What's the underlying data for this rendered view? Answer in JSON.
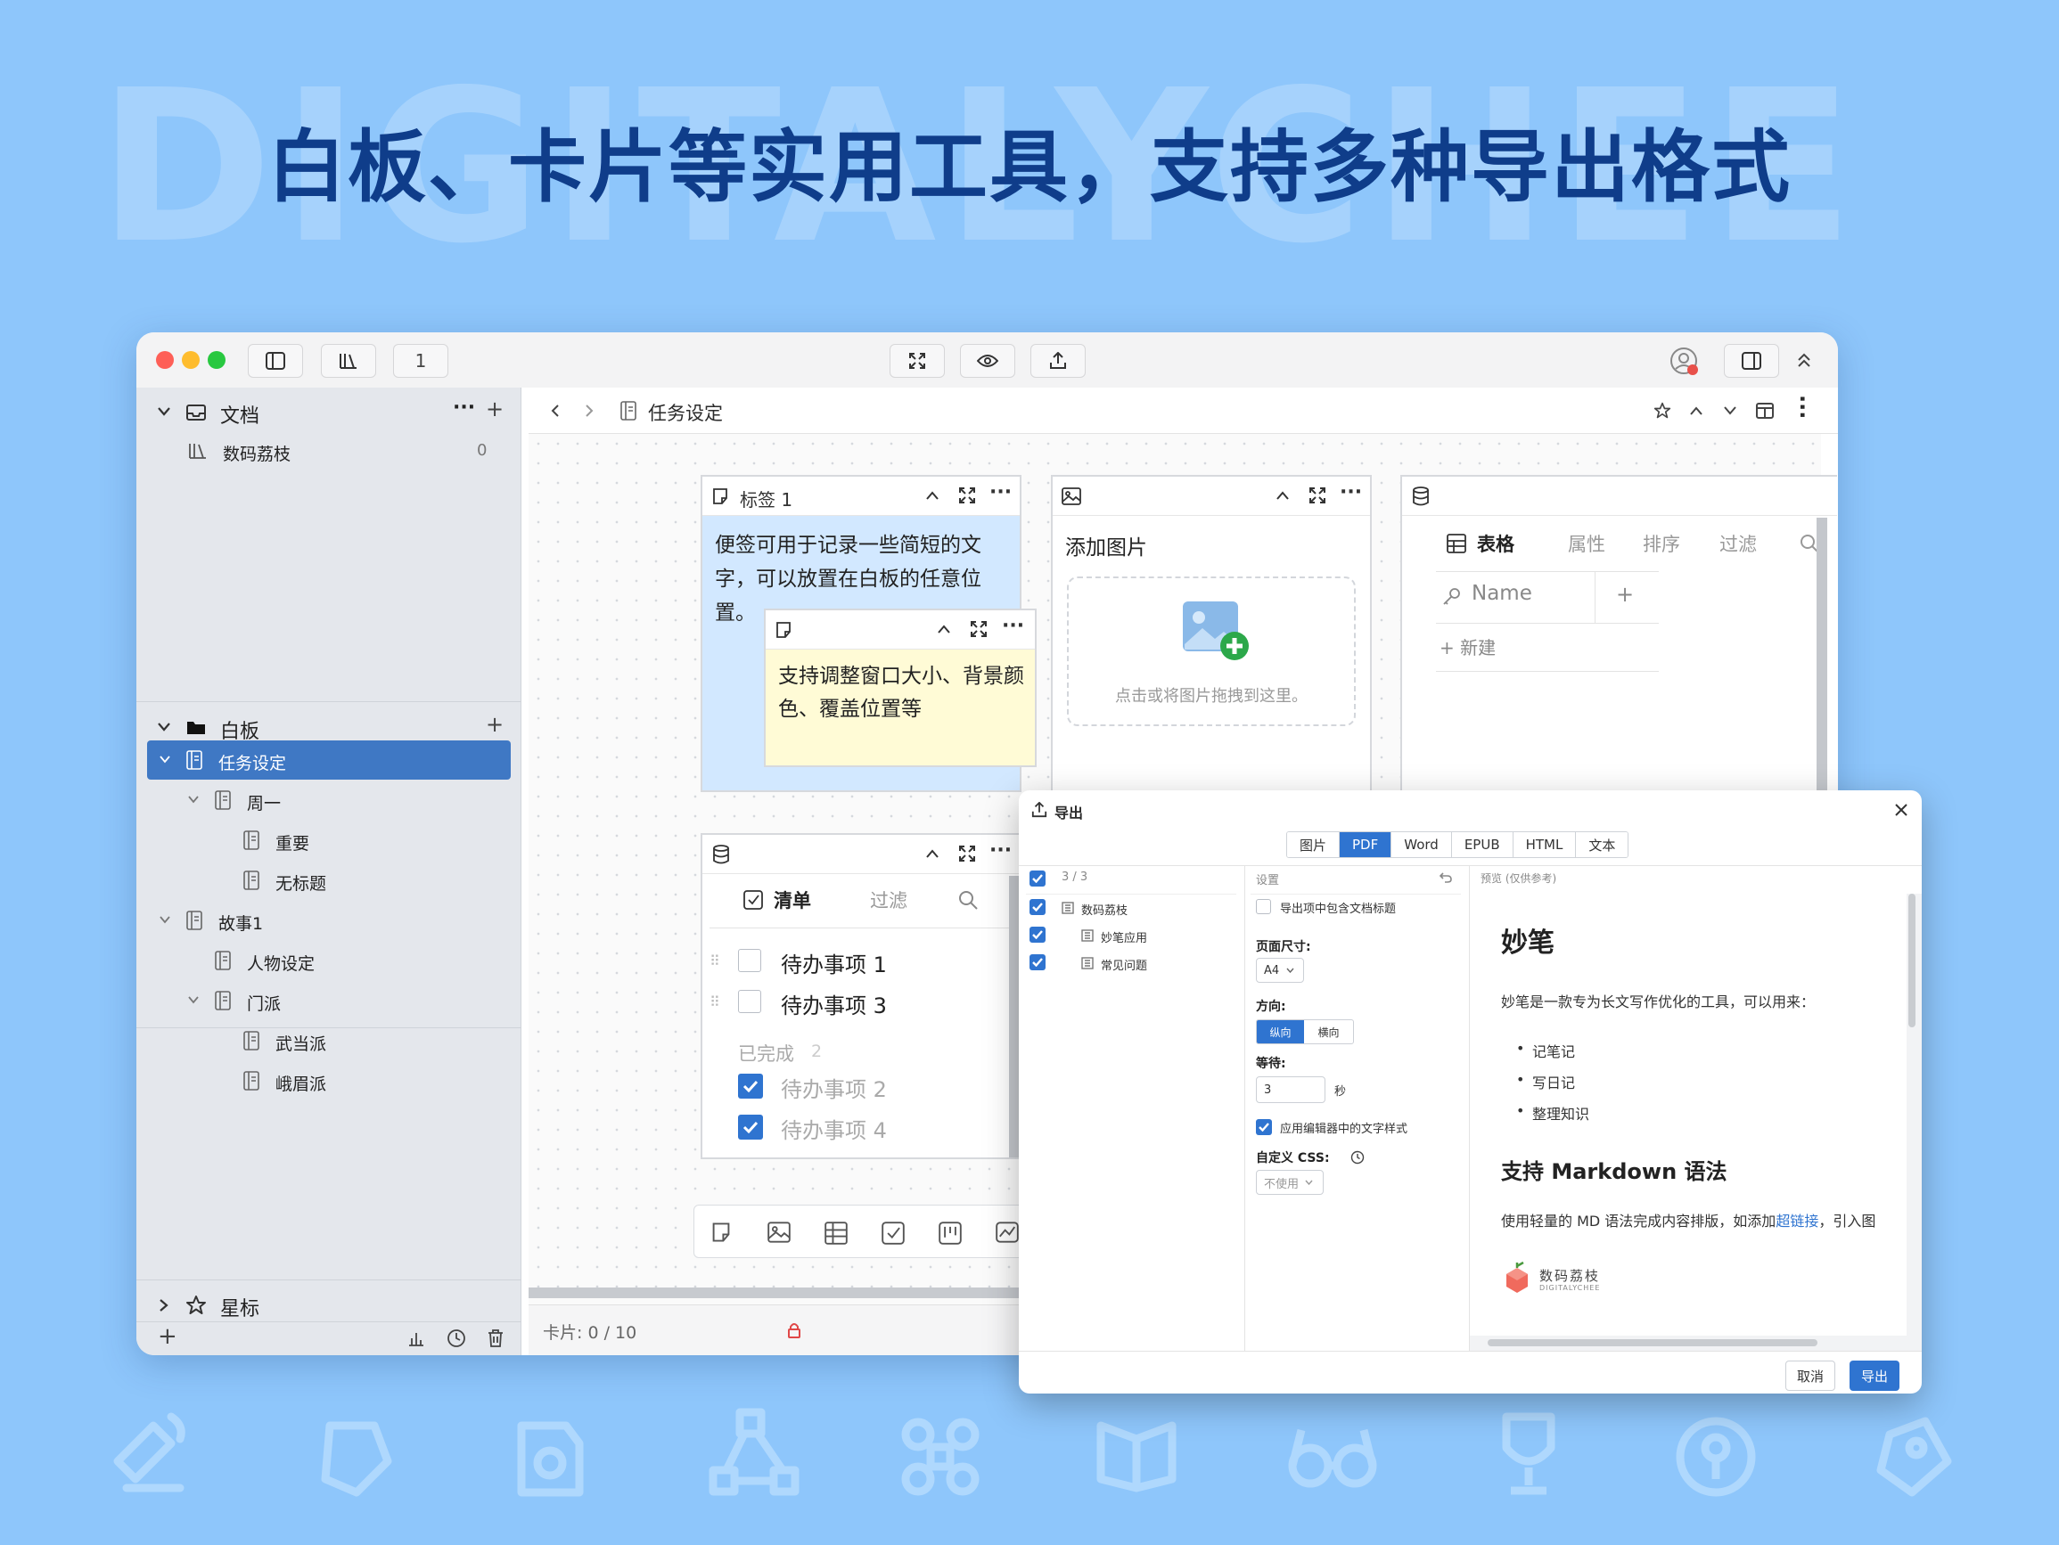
{
  "background": {
    "watermark": "DIGITALYCHEE",
    "headline": "白板、卡片等实用工具，支持多种导出格式",
    "color": "#8ec6fb",
    "icons": [
      "pen-wave-icon",
      "sticky-note-icon",
      "image-lock-icon",
      "vector-nodes-icon",
      "command-icon",
      "book-icon",
      "glasses-icon",
      "trophy-icon",
      "key-icon",
      "tag-icon"
    ]
  },
  "window": {
    "toolbar": {
      "page_count": "1"
    },
    "sidebar": {
      "docs": {
        "title": "文档",
        "items": [
          {
            "label": "数码荔枝",
            "count": "0"
          }
        ]
      },
      "board": {
        "title": "白板",
        "items": [
          {
            "label": "任务设定"
          },
          {
            "label": "周一"
          },
          {
            "label": "重要"
          },
          {
            "label": "无标题"
          },
          {
            "label": "故事1"
          },
          {
            "label": "人物设定"
          },
          {
            "label": "门派"
          },
          {
            "label": "武当派"
          },
          {
            "label": "峨眉派"
          }
        ]
      },
      "starred": {
        "title": "星标"
      }
    },
    "main": {
      "breadcrumb": "任务设定",
      "note_card": {
        "title": "标签 1",
        "text": "便签可用于记录一些简短的文字，可以放置在白板的任意位置。"
      },
      "sub_note": {
        "text": "支持调整窗口大小、背景颜色、覆盖位置等"
      },
      "image_card": {
        "title": "添加图片",
        "hint": "点击或将图片拖拽到这里。"
      },
      "table_card": {
        "tabs": [
          "表格",
          "属性",
          "排序",
          "过滤"
        ],
        "column": "Name",
        "new_label": "+ 新建"
      },
      "todo_card": {
        "tabs": [
          "清单",
          "过滤"
        ],
        "open": [
          "待办事项 1",
          "待办事项 3"
        ],
        "done_label": "已完成",
        "done_count": "2",
        "done": [
          "待办事项 2",
          "待办事项 4"
        ]
      },
      "status": "卡片: 0 / 10"
    }
  },
  "export_dialog": {
    "title": "导出",
    "tabs": [
      "图片",
      "PDF",
      "Word",
      "EPUB",
      "HTML",
      "文本"
    ],
    "active_tab": "PDF",
    "selection_count": "3 / 3",
    "tree": [
      {
        "label": "数码荔枝",
        "checked": true
      },
      {
        "label": "妙笔应用",
        "checked": true
      },
      {
        "label": "常见问题",
        "checked": true
      }
    ],
    "settings": {
      "header": "设置",
      "include_title": "导出项中包含文档标题",
      "page_size_label": "页面尺寸:",
      "page_size": "A4",
      "orientation_label": "方向:",
      "orientation_options": [
        "纵向",
        "横向"
      ],
      "wait_label": "等待:",
      "wait_value": "3",
      "wait_unit": "秒",
      "apply_styles": "应用编辑器中的文字样式",
      "css_label": "自定义 CSS:",
      "css_value": "不使用"
    },
    "preview": {
      "header": "预览 (仅供参考)",
      "h1": "妙笔",
      "intro": "妙笔是一款专为长文写作优化的工具，可以用来：",
      "bullets": [
        "记笔记",
        "写日记",
        "整理知识"
      ],
      "h2": "支持 Markdown 语法",
      "para_before": "使用轻量的 MD 语法完成内容排版，如添加",
      "para_link": "超链接",
      "para_after": "，引入图",
      "logo_cn": "数码荔枝",
      "logo_en": "DIGITALYCHEE"
    },
    "cancel": "取消",
    "export": "导出"
  }
}
